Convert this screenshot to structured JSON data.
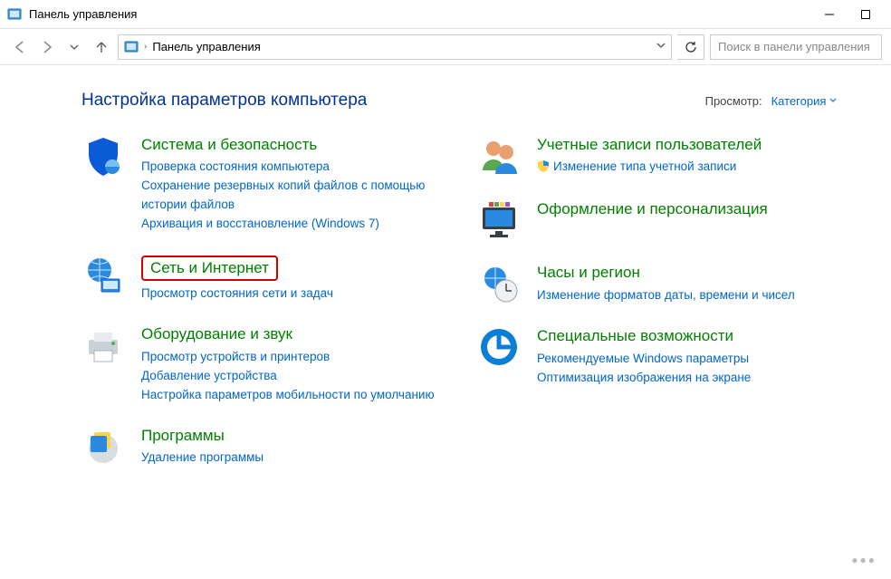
{
  "window": {
    "title": "Панель управления"
  },
  "address": {
    "path": "Панель управления"
  },
  "search": {
    "placeholder": "Поиск в панели управления"
  },
  "header": {
    "title": "Настройка параметров компьютера",
    "viewby_label": "Просмотр:",
    "viewby_value": "Категория"
  },
  "categories": {
    "system": {
      "title": "Система и безопасность",
      "links": [
        "Проверка состояния компьютера",
        "Сохранение резервных копий файлов с помощью истории файлов",
        "Архивация и восстановление (Windows 7)"
      ]
    },
    "network": {
      "title": "Сеть и Интернет",
      "links": [
        "Просмотр состояния сети и задач"
      ]
    },
    "hardware": {
      "title": "Оборудование и звук",
      "links": [
        "Просмотр устройств и принтеров",
        "Добавление устройства",
        "Настройка параметров мобильности по умолчанию"
      ]
    },
    "programs": {
      "title": "Программы",
      "links": [
        "Удаление программы"
      ]
    },
    "accounts": {
      "title": "Учетные записи пользователей",
      "links": [
        "Изменение типа учетной записи"
      ]
    },
    "appearance": {
      "title": "Оформление и персонализация"
    },
    "clock": {
      "title": "Часы и регион",
      "links": [
        "Изменение форматов даты, времени и чисел"
      ]
    },
    "ease": {
      "title": "Специальные возможности",
      "links": [
        "Рекомендуемые Windows параметры",
        "Оптимизация изображения на экране"
      ]
    }
  }
}
